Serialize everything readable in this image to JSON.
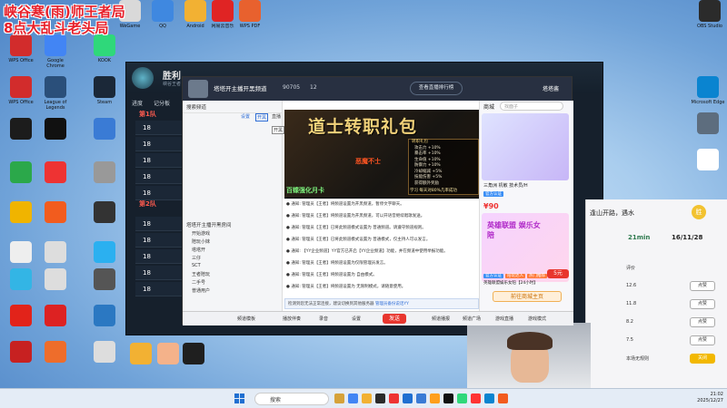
{
  "overlay": {
    "line1": "峡谷寒(雨)师王者局",
    "line2": "8点大乱斗老头局"
  },
  "desktop_icons": [
    {
      "label": "WeGame",
      "color": "#d9d9d9"
    },
    {
      "label": "QQ",
      "color": "#3f88e0"
    },
    {
      "label": "Android",
      "color": "#f2b133"
    },
    {
      "label": "网易云音乐",
      "color": "#e02424"
    },
    {
      "label": "WPS PDF",
      "color": "#e8612e"
    },
    {
      "label": "OBS Studio",
      "color": "#2b2b2b"
    },
    {
      "label": "WPS Office",
      "color": "#d22c2c"
    },
    {
      "label": "Google Chrome",
      "color": "#4285f4"
    },
    {
      "label": "KOOK",
      "color": "#2fd87a"
    },
    {
      "label": "WPS Office",
      "color": "#d22c2c"
    },
    {
      "label": "League of Legends",
      "color": "#2a4f7a"
    },
    {
      "label": "Steam",
      "color": "#1b2838"
    },
    {
      "label": "Microsoft Edge",
      "color": "#0a84d0"
    }
  ],
  "game": {
    "title": "胜利",
    "subtitle": "峡谷王者 · 大乱斗",
    "tabs": [
      "进度",
      "记分板"
    ],
    "team1": "第1队",
    "team2": "第2队",
    "rows": [
      "18",
      "18",
      "18",
      "18",
      "18",
      "18",
      "18",
      "18",
      "18",
      "18"
    ]
  },
  "chat": {
    "room_title": "塔塔开主播开黑频道",
    "viewers": "90705",
    "count": "12",
    "follow_button": "查看直播排行榜",
    "username": "塔塔酱",
    "left_search": "搜索频道",
    "section_title": "塔塔开主播开黑房间",
    "members": [
      "开始游戏",
      "陪玩小妹",
      "塔塔开",
      "三仔",
      "SCT",
      "王者陪玩",
      "二手号",
      "普通用户"
    ],
    "tab_labels": [
      "设置",
      "开黑",
      "直播"
    ],
    "tab_hint": "开黑",
    "poster_title": "道士转职礼包",
    "poster_box_title": "转职礼包",
    "poster_lines": [
      "攻击力 +10%",
      "暴击率 +10%",
      "生命值 +10%",
      "防御力 +10%",
      "冷却缩减 +5%",
      "技能伤害 +5%",
      "获得额外奖励"
    ],
    "poster_red": "恶魔不士",
    "poster_green": "百蝶强化月卡",
    "poster_note": "学习 每天对80%几率成功",
    "messages": [
      "通知: 管理员【王者】将频道设置为开黑频道，暂停文字聊天。",
      "通知: 管理员【王者】将频道设置为开黑频道，可以开语音继续唱歌发送。",
      "通知: 管理员【王者】已将此频道模式设置为 普通频道。请遵守频道规则。",
      "通知: 管理员【王者】已将此频道模式设置为 普通模式，仅主持人可以发言。",
      "通知: 【YY企业频道】YY官方已开启【YY企业频道】功能，并在频道中使用举报功能。",
      "通知: 管理员【王者】将频道设置为仅限管理员发言。",
      "通知: 管理员【王者】将频道设置为 自由模式。",
      "通知: 管理员【王者】将频道设置为 无限制模式，请随意使用。"
    ],
    "input_placeholder": "检测到您无法正常连接，建议切换到其他服务器",
    "input_link": "管理员备份说话YY",
    "send_button": "发送",
    "bottom_bar": [
      "频道模板",
      "播放伴奏",
      "录音",
      "设置",
      "频道播报",
      "频道广场",
      "游戏直播",
      "游戏模式"
    ],
    "shop_title": "商城",
    "shop_search": "找面子",
    "shop_card1": {
      "title": "三角洲 机敏 技术员/H",
      "price": "¥90",
      "badges": [
        "官方认证",
        "1.5w"
      ]
    },
    "shop_card2": {
      "title": "英雄联盟娱乐女陪【24小时】",
      "badges": [
        "官方认证",
        "陪玩达人",
        "热门推荐"
      ],
      "price": "5元"
    },
    "shop_banner": "英雄联盟 娱乐女陪",
    "shop_buy": "前往商城主页"
  },
  "rpanel": {
    "header": "逢山开路，遇水",
    "badge": "胜",
    "stats": [
      {
        "label": "21min",
        "value": "16/11/28"
      }
    ],
    "rows": [
      {
        "label": "评价",
        "button": ""
      },
      {
        "label": "12.6",
        "button": "点赞"
      },
      {
        "label": "11.8",
        "button": "点赞"
      },
      {
        "label": "8.2",
        "button": "点赞"
      },
      {
        "label": "7.5",
        "button": "点赞"
      },
      {
        "label": "本场无规则",
        "button": "关闭"
      }
    ]
  },
  "taskbar": {
    "search": "搜索",
    "time": "21:02",
    "date": "2025/12/27"
  }
}
